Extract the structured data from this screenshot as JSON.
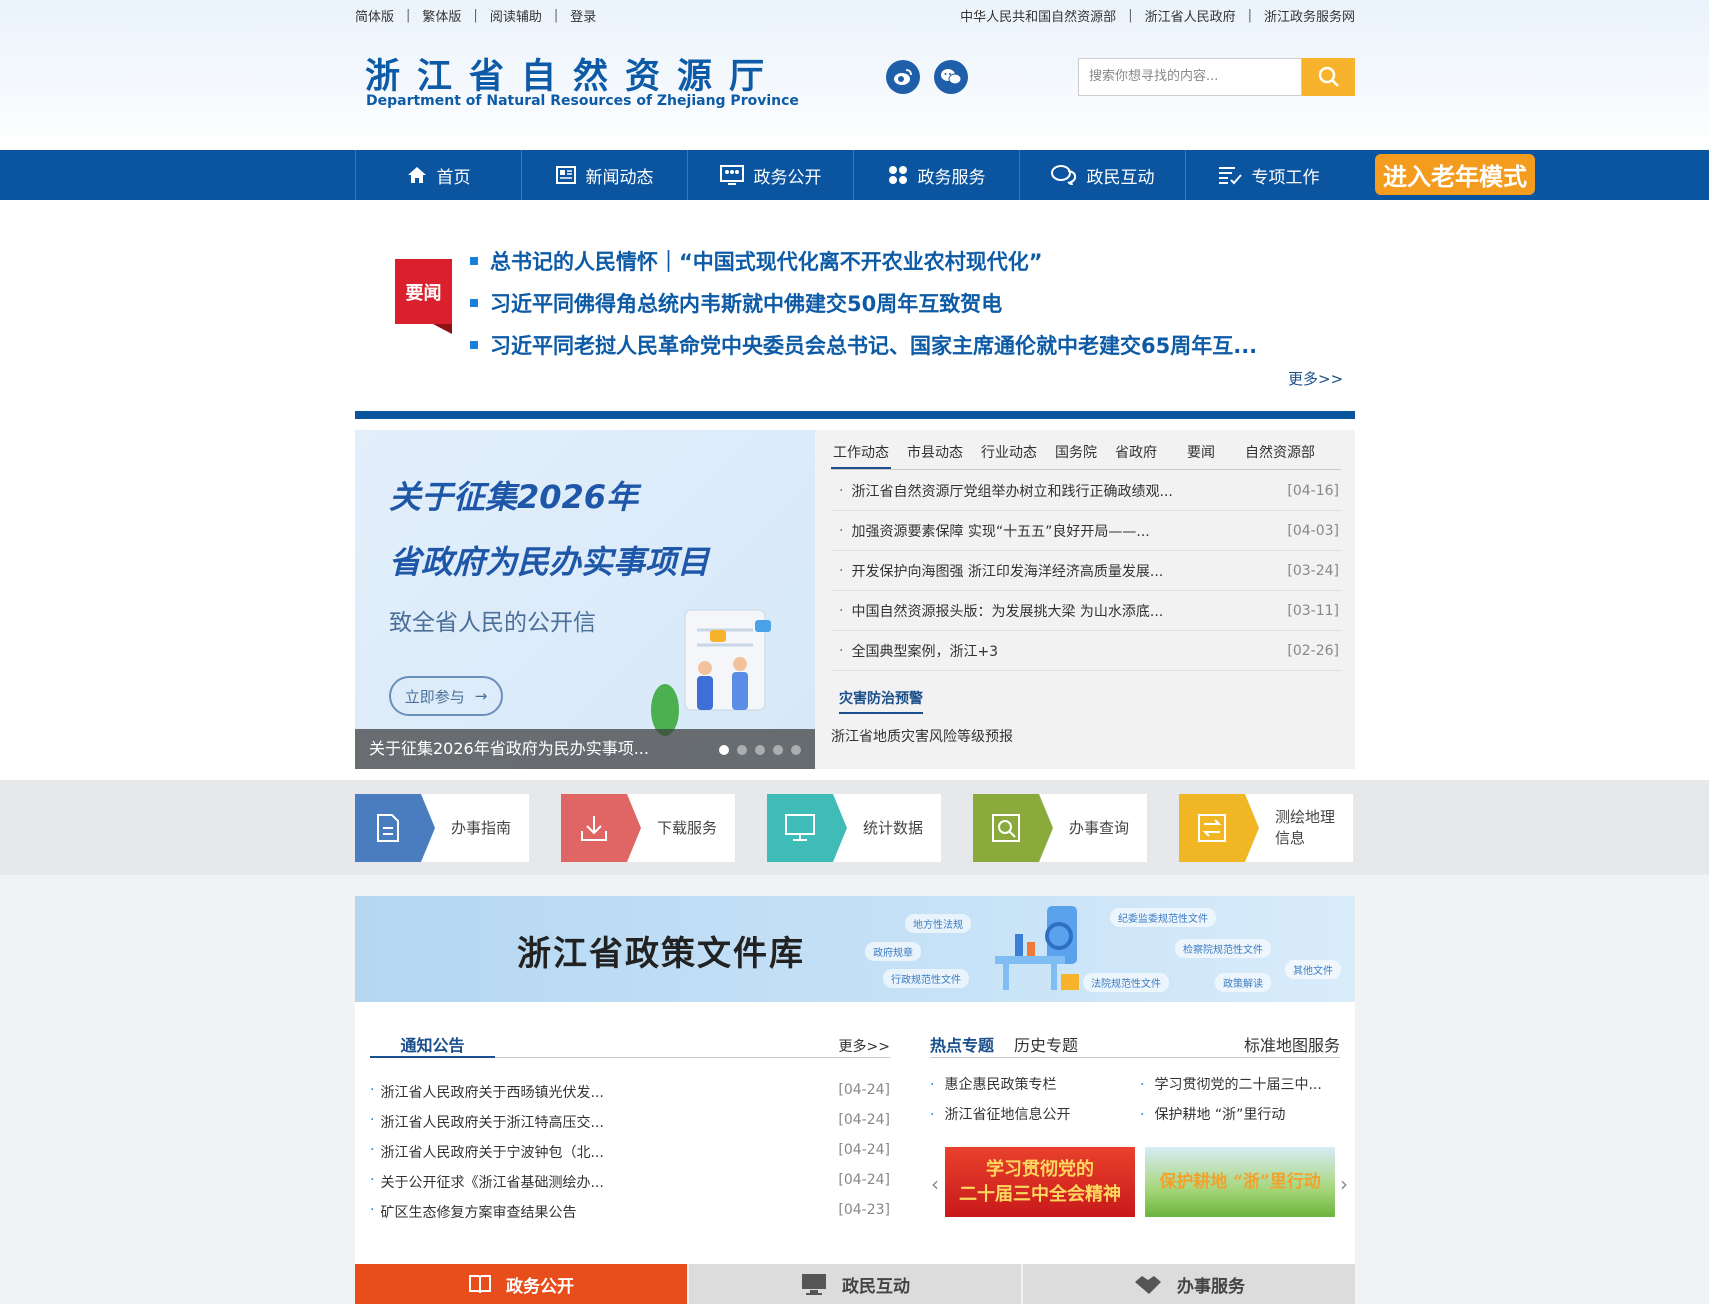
{
  "top_links_left": [
    "简体版",
    "繁体版",
    "阅读辅助",
    "登录"
  ],
  "top_links_right": [
    "中华人民共和国自然资源部",
    "浙江省人民政府",
    "浙江政务服务网"
  ],
  "logo": {
    "cn": "浙江省自然资源厅",
    "en": "Department of Natural Resources of Zhejiang Province"
  },
  "search": {
    "placeholder": "搜索你想寻找的内容..."
  },
  "nav": [
    "首页",
    "新闻动态",
    "政务公开",
    "政务服务",
    "政民互动",
    "专项工作"
  ],
  "elder_mode": "进入老年模式",
  "headlines": {
    "badge": "要闻",
    "items": [
      "总书记的人民情怀｜“中国式现代化离不开农业农村现代化”",
      "习近平同佛得角总统内韦斯就中佛建交50周年互致贺电",
      "习近平同老挝人民革命党中央委员会总书记、国家主席通伦就中老建交65周年互..."
    ],
    "more": "更多>>"
  },
  "banner": {
    "line1": "关于征集2026年",
    "line2": "省政府为民办实事项目",
    "line3": "致全省人民的公开信",
    "button": "立即参与",
    "caption": "关于征集2026年省政府为民办实事项..."
  },
  "news": {
    "tabs": [
      "工作动态",
      "市县动态",
      "行业动态",
      "国务院",
      "省政府",
      "要闻",
      "自然资源部"
    ],
    "items": [
      {
        "title": "浙江省自然资源厅党组举办树立和践行正确政绩观...",
        "date": "[04-16]"
      },
      {
        "title": "加强资源要素保障 实现“十五五”良好开局——...",
        "date": "[04-03]"
      },
      {
        "title": "开发保护向海图强 浙江印发海洋经济高质量发展...",
        "date": "[03-24]"
      },
      {
        "title": "中国自然资源报头版：为发展挑大梁 为山水添底...",
        "date": "[03-11]"
      },
      {
        "title": "全国典型案例，浙江+3",
        "date": "[02-26]"
      }
    ],
    "disaster_title": "灾害防治预警",
    "disaster_text": "浙江省地质灾害风险等级预报"
  },
  "services": [
    {
      "label": "办事指南",
      "color": "#4a7dc0"
    },
    {
      "label": "下载服务",
      "color": "#e06666"
    },
    {
      "label": "统计数据",
      "color": "#3fbcb7"
    },
    {
      "label": "办事查询",
      "color": "#8aab3c"
    },
    {
      "label": "测绘地理\n信息",
      "color": "#f0b623"
    }
  ],
  "policy": {
    "title": "浙江省政策文件库",
    "tags": [
      "地方性法规",
      "纪委监委规范性文件",
      "政府规章",
      "检察院规范性文件",
      "行政规范性文件",
      "法院规范性文件",
      "政策解读",
      "其他文件"
    ]
  },
  "notices": {
    "title": "通知公告",
    "more": "更多>>",
    "items": [
      {
        "title": "浙江省人民政府关于西旸镇光伏发...",
        "date": "[04-24]"
      },
      {
        "title": "浙江省人民政府关于浙江特高压交...",
        "date": "[04-24]"
      },
      {
        "title": "浙江省人民政府关于宁波钟包（北...",
        "date": "[04-24]"
      },
      {
        "title": "关于公开征求《浙江省基础测绘办...",
        "date": "[04-24]"
      },
      {
        "title": "矿区生态修复方案审查结果公告",
        "date": "[04-23]"
      }
    ]
  },
  "hot": {
    "tab1": "热点专题",
    "tab2": "历史专题",
    "tab3": "标准地图服务",
    "items": [
      "惠企惠民政策专栏",
      "学习贯彻党的二十届三中...",
      "浙江省征地信息公开",
      "保护耕地 “浙”里行动"
    ],
    "card1": "学习贯彻党的\n二十届三中全会精神",
    "card2": "保护耕地 “浙”里行动"
  },
  "footer_tabs": [
    "政务公开",
    "政民互动",
    "办事服务"
  ],
  "colors": {
    "brand": "#0b55a0",
    "accent": "#f39c1e",
    "footer_active": "#e84e1b"
  }
}
